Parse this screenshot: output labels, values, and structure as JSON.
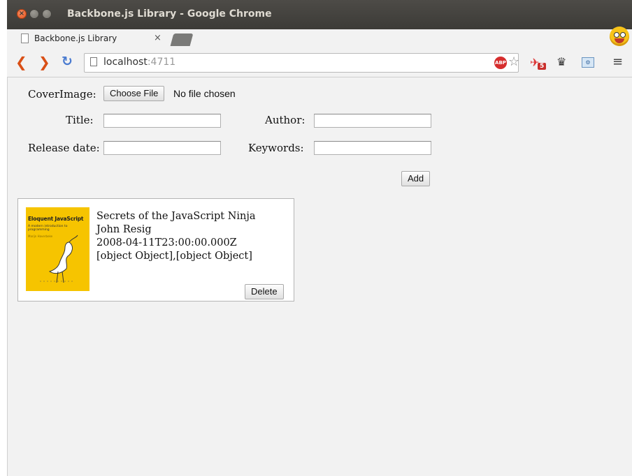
{
  "window": {
    "title": "Backbone.js Library - Google Chrome"
  },
  "tab": {
    "title": "Backbone.js Library",
    "close": "×"
  },
  "toolbar": {
    "url_host": "localhost",
    "url_port": ":4711",
    "adblock_label": "ABP",
    "extension_badge": "5"
  },
  "form": {
    "cover_label": "CoverImage:",
    "choose_file_label": "Choose File",
    "no_file_text": "No file chosen",
    "title_label": "Title:",
    "title_value": "",
    "author_label": "Author:",
    "author_value": "",
    "release_label": "Release date:",
    "release_value": "",
    "keywords_label": "Keywords:",
    "keywords_value": "",
    "add_label": "Add"
  },
  "books": [
    {
      "cover_title": "Eloquent JavaScript",
      "cover_subtitle": "A modern introduction to programming",
      "cover_author": "Marijn Haverbeke",
      "title": "Secrets of the JavaScript Ninja",
      "author": "John Resig",
      "release_date": "2008-04-11T23:00:00.000Z",
      "keywords": "[object Object],[object Object]",
      "delete_label": "Delete"
    }
  ]
}
